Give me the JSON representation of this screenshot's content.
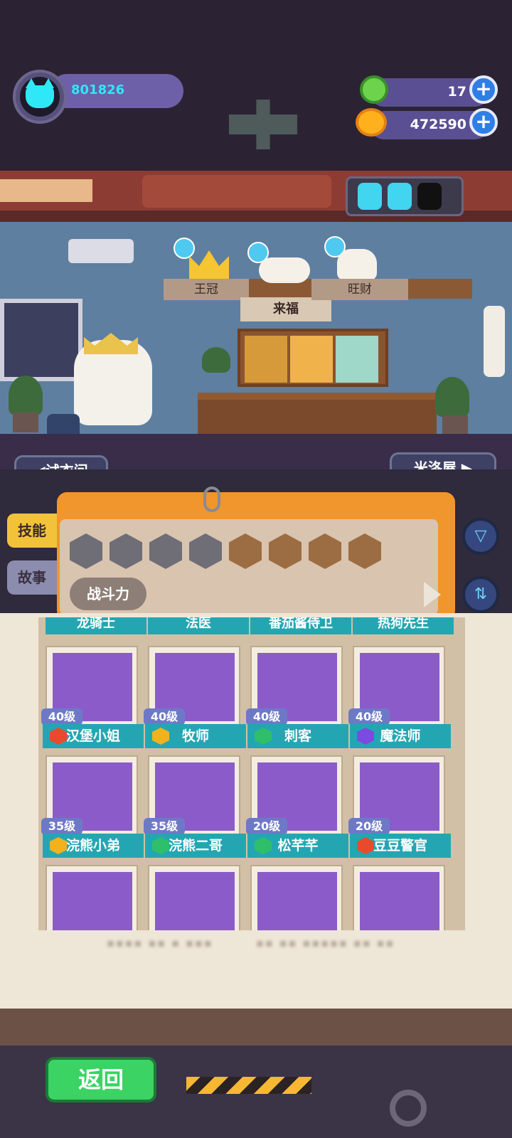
{
  "player": {
    "id": "801826",
    "avatar_icon": "cat-face-icon"
  },
  "resources": {
    "gems": "17",
    "coins": "472590"
  },
  "room": {
    "shelf_tabs": [
      "王冠",
      "来福",
      "旺财"
    ],
    "nav_left": "◀试衣间",
    "nav_right": "米洛屋 ▶"
  },
  "panel": {
    "tabs": {
      "skill": "技能",
      "story": "故事"
    },
    "sort_label": "战斗力"
  },
  "top_row_names": [
    "龙骑士",
    "法医",
    "番茄酱侍卫",
    "热狗先生"
  ],
  "characters": [
    {
      "level": "40级",
      "name": "汉堡小姐",
      "class_color": "#e84b2c",
      "portrait_color": "#8b5cc9"
    },
    {
      "level": "40级",
      "name": "牧师",
      "class_color": "#f1b21d",
      "portrait_color": "#8b5cc9"
    },
    {
      "level": "40级",
      "name": "刺客",
      "class_color": "#2fbf6a",
      "portrait_color": "#8b5cc9"
    },
    {
      "level": "40级",
      "name": "魔法师",
      "class_color": "#7b4ae0",
      "portrait_color": "#8b5cc9"
    },
    {
      "level": "35级",
      "name": "浣熊小弟",
      "class_color": "#f1b21d",
      "portrait_color": "#8b5cc9"
    },
    {
      "level": "35级",
      "name": "浣熊二哥",
      "class_color": "#2fbf6a",
      "portrait_color": "#8b5cc9"
    },
    {
      "level": "20级",
      "name": "松芊芊",
      "class_color": "#2fbf6a",
      "portrait_color": "#8b5cc9"
    },
    {
      "level": "20级",
      "name": "豆豆警官",
      "class_color": "#e84b2c",
      "portrait_color": "#8b5cc9"
    }
  ],
  "back_button": "返回"
}
